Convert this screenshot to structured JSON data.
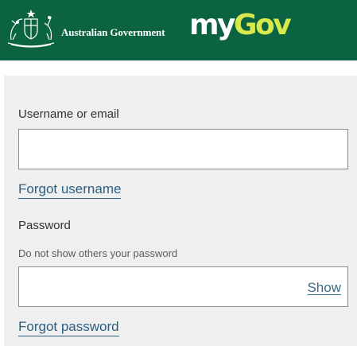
{
  "header": {
    "government_name": "Australian Government",
    "brand_part1": "my",
    "brand_part2": "Gov",
    "crest_icon": "coat-of-arms-icon",
    "colors": {
      "background": "#0b6342",
      "brand_accent": "#d8e94c"
    }
  },
  "login": {
    "username_label": "Username or email",
    "username_value": "",
    "forgot_username": "Forgot username",
    "password_label": "Password",
    "password_hint": "Do not show others your password",
    "password_value": "",
    "show_label": "Show",
    "forgot_password": "Forgot password"
  }
}
